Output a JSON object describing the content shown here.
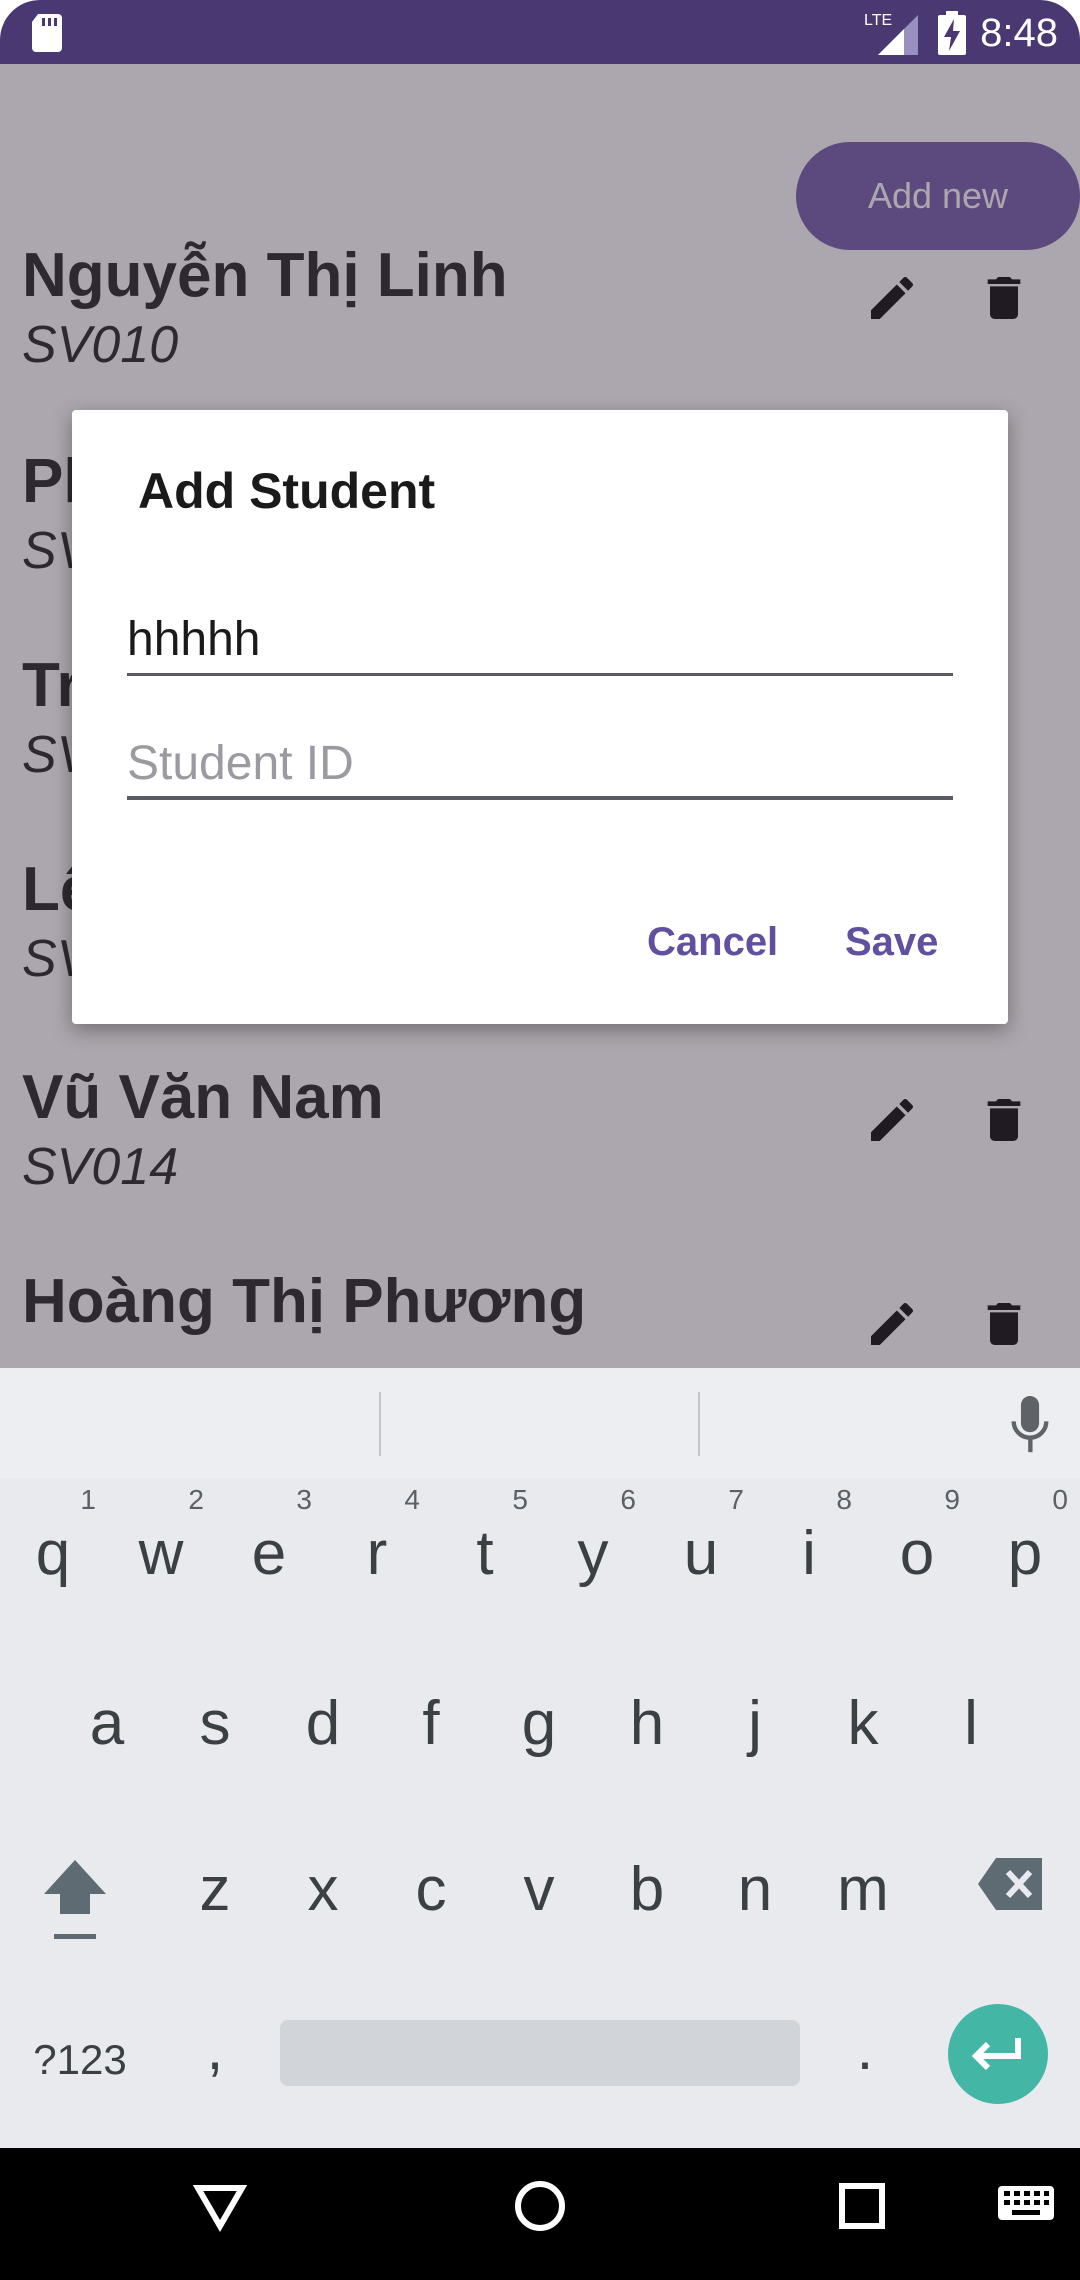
{
  "status_bar": {
    "time": "8:48",
    "network": "LTE"
  },
  "app": {
    "add_new_label": "Add new"
  },
  "students": [
    {
      "name": "Nguyễn Thị Linh",
      "id": "SV010"
    },
    {
      "name": "Ph",
      "id": "SV"
    },
    {
      "name": "Tr",
      "id": "SV"
    },
    {
      "name": "Lê",
      "id": "SV"
    },
    {
      "name": "Vũ Văn Nam",
      "id": "SV014"
    },
    {
      "name": "Hoàng Thị Phương",
      "id": ""
    }
  ],
  "dialog": {
    "title": "Add Student",
    "name_value": "hhhhh",
    "id_placeholder": "Student ID",
    "cancel_label": "Cancel",
    "save_label": "Save"
  },
  "keyboard": {
    "row1": [
      "q",
      "w",
      "e",
      "r",
      "t",
      "y",
      "u",
      "i",
      "o",
      "p"
    ],
    "row1_hints": [
      "1",
      "2",
      "3",
      "4",
      "5",
      "6",
      "7",
      "8",
      "9",
      "0"
    ],
    "row2": [
      "a",
      "s",
      "d",
      "f",
      "g",
      "h",
      "j",
      "k",
      "l"
    ],
    "row3": [
      "z",
      "x",
      "c",
      "v",
      "b",
      "n",
      "m"
    ],
    "symbols_label": "?123",
    "comma": ",",
    "period": "."
  },
  "colors": {
    "accent": "#6150a0",
    "status_bar": "#4a3873",
    "enter_key": "#43b6a6"
  }
}
